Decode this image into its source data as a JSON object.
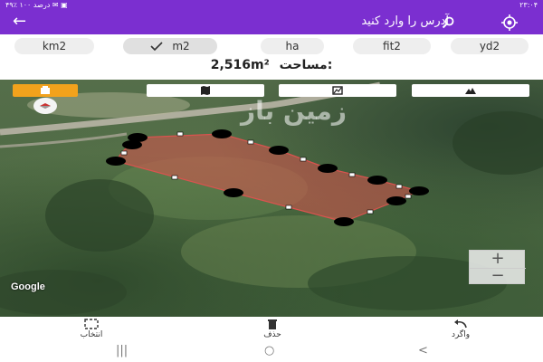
{
  "status": {
    "left": "۴۹٪ درصد ۱۰۰ ✉ ▣",
    "time": "۲۳:۰۴"
  },
  "header": {
    "title": "آدرس را وارد کنید",
    "search_icon": "search-icon",
    "gps_icon": "gps-target-icon",
    "back_icon": "back-arrow-icon",
    "colors": {
      "primary": "#7b2fd0"
    }
  },
  "units": [
    {
      "label": "km2",
      "selected": false
    },
    {
      "label": "m2",
      "selected": true
    },
    {
      "label": "ha",
      "selected": false
    },
    {
      "label": "fit2",
      "selected": false
    },
    {
      "label": "yd2",
      "selected": false
    }
  ],
  "area": {
    "label": "مساحت:",
    "value": "2,516m²"
  },
  "map": {
    "tools": [
      "layers-icon",
      "map-icon",
      "satellite-icon",
      "terrain-icon"
    ],
    "watermark": "زمین باز",
    "google": "Google",
    "zoom_in": "+",
    "zoom_out": "−",
    "colors": {
      "polygon_fill": "#d9534f",
      "active_tool": "#f2a21c"
    }
  },
  "toolbar": {
    "select": "انتخاب",
    "delete": "حذف",
    "undo": "واگرد"
  },
  "nav": {
    "recents": "|||",
    "home": "○",
    "back": "<"
  }
}
